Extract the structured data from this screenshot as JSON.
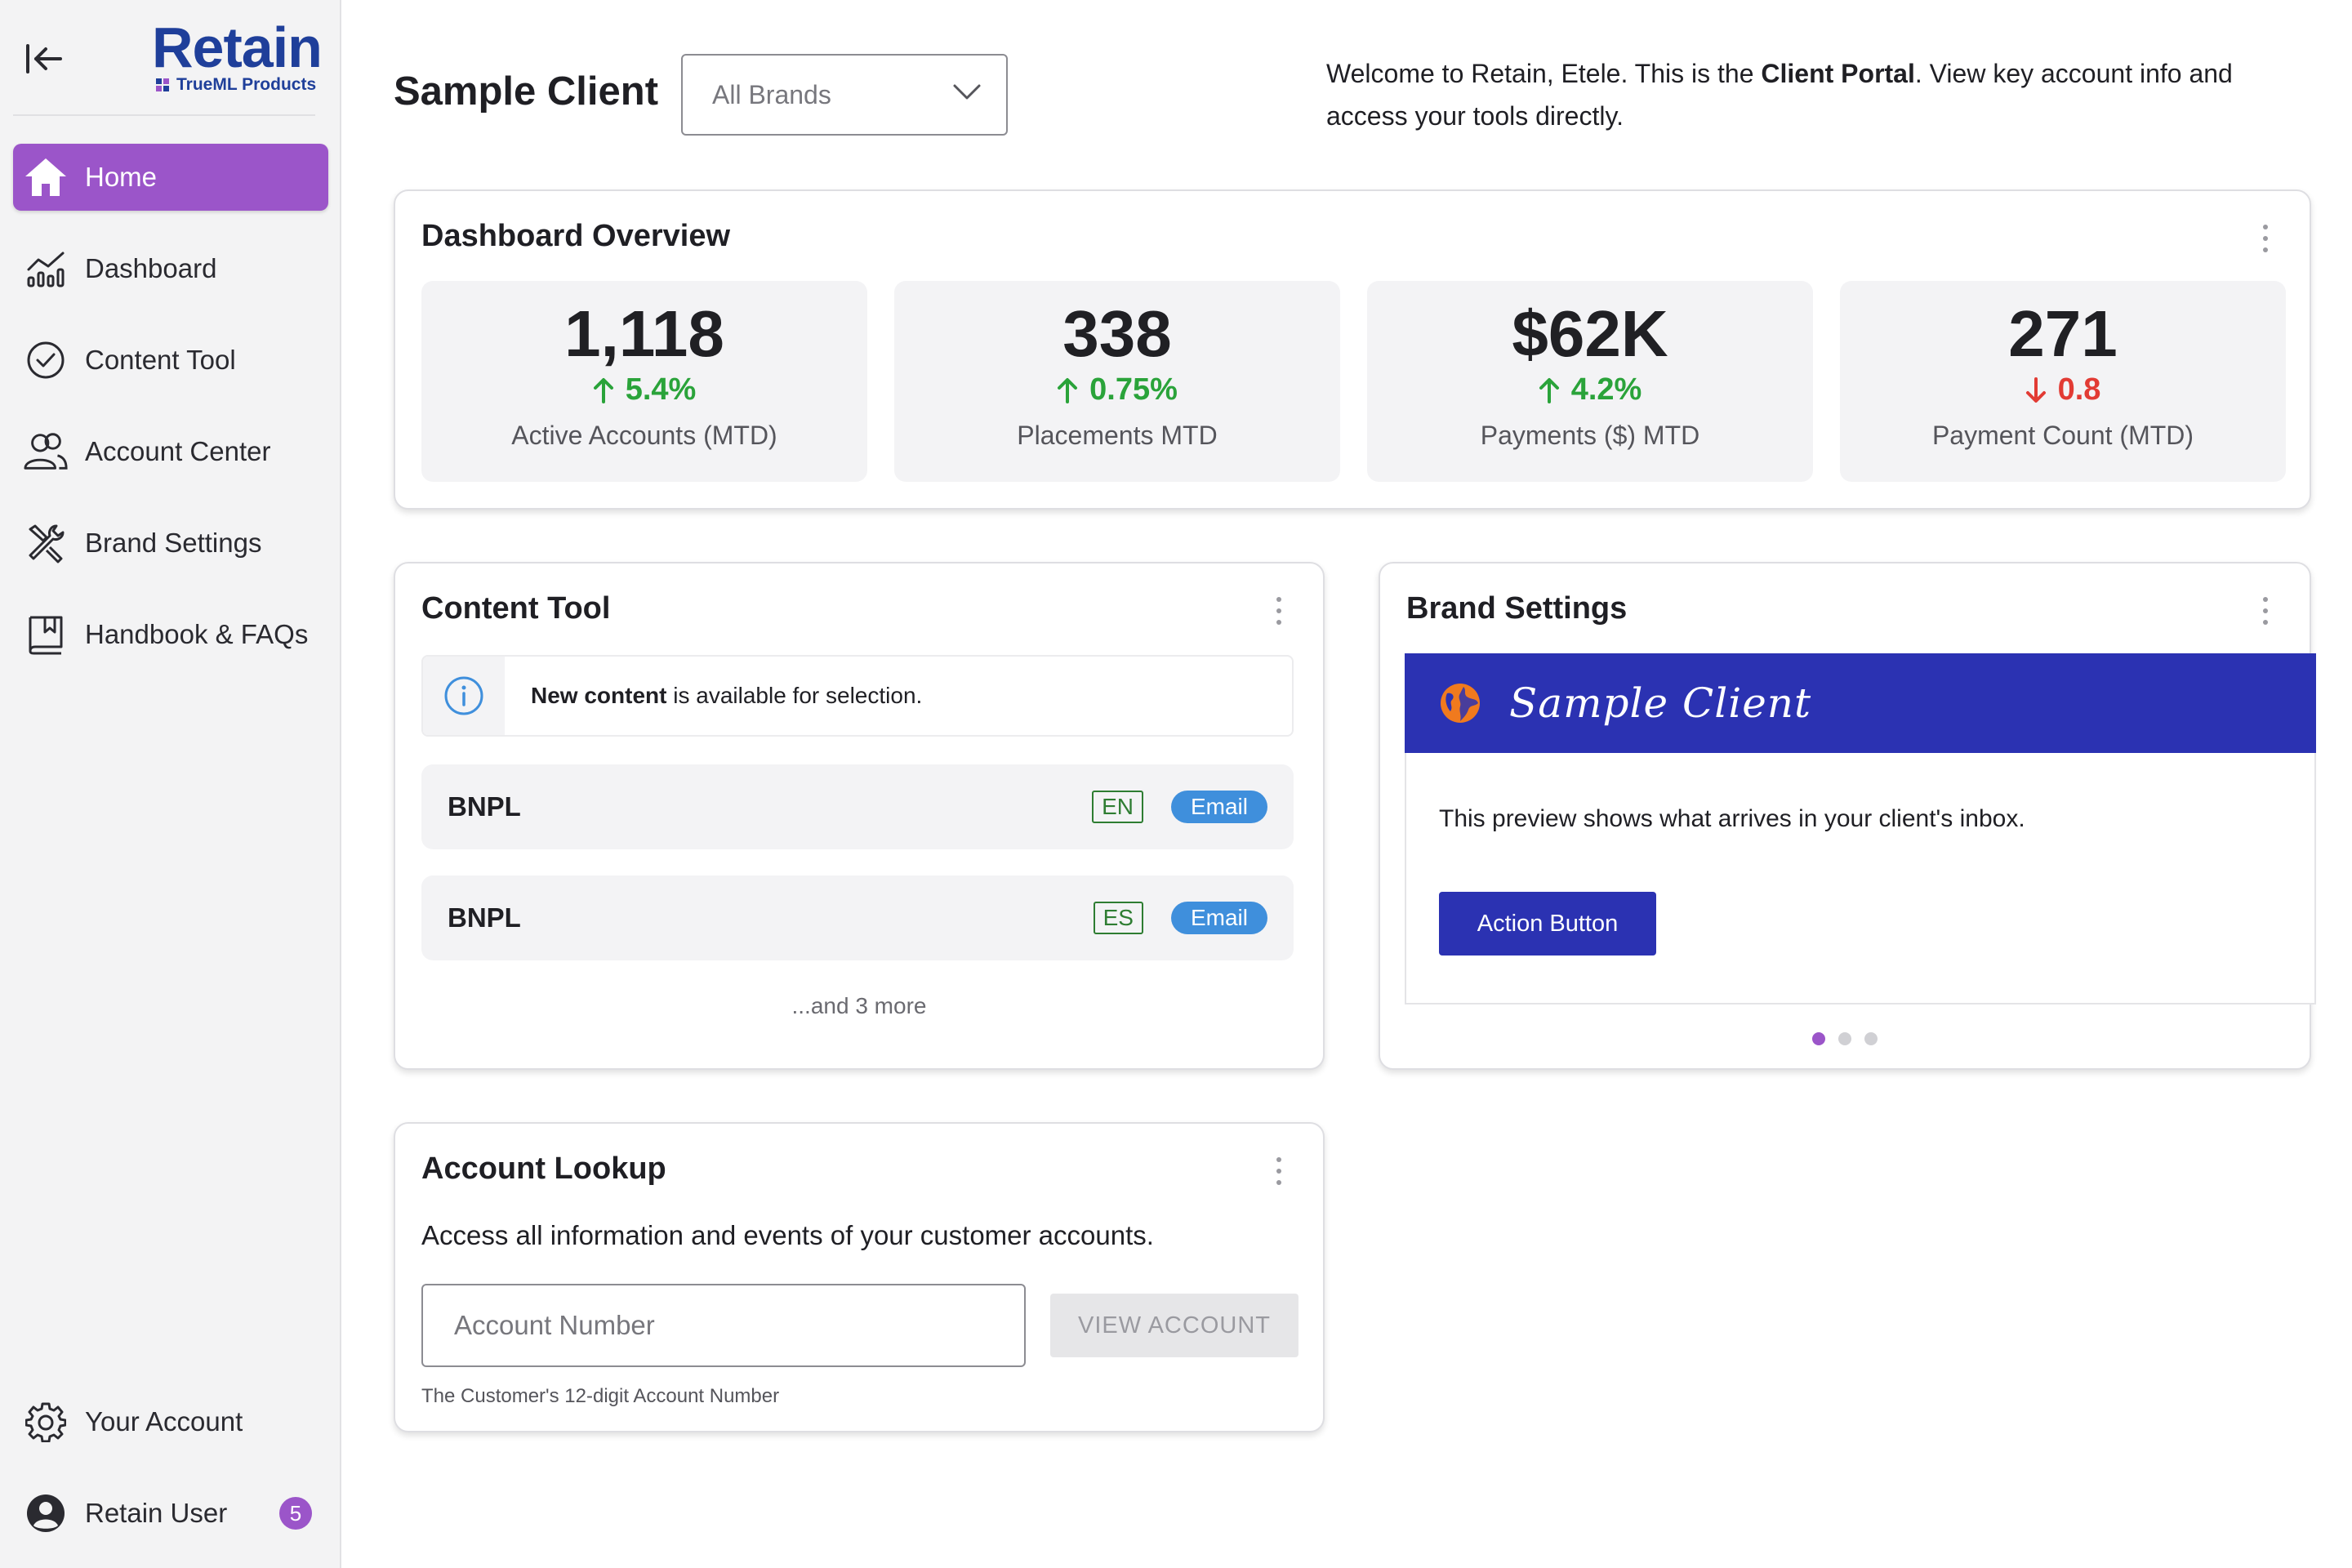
{
  "app": {
    "logo_title": "Retain",
    "logo_subtitle": "TrueML Products",
    "brand_color": "#1f3f9a",
    "accent_color": "#9b55c9"
  },
  "sidebar": {
    "items": [
      {
        "label": "Home",
        "icon": "home-icon",
        "active": true
      },
      {
        "label": "Dashboard",
        "icon": "chart-icon"
      },
      {
        "label": "Content Tool",
        "icon": "check-circle-icon"
      },
      {
        "label": "Account Center",
        "icon": "users-icon"
      },
      {
        "label": "Brand Settings",
        "icon": "tools-icon"
      },
      {
        "label": "Handbook & FAQs",
        "icon": "book-icon"
      }
    ],
    "bottom": [
      {
        "label": "Your Account",
        "icon": "gear-icon"
      },
      {
        "label": "Retain User",
        "icon": "user-avatar-icon",
        "badge": "5"
      }
    ]
  },
  "header": {
    "title": "Sample Client",
    "brand_select": "All Brands",
    "welcome_prefix": "Welcome to Retain, Etele. This is the ",
    "welcome_bold": "Client Portal",
    "welcome_suffix": ". View key account info and access your tools directly."
  },
  "overview": {
    "title": "Dashboard Overview",
    "stats": [
      {
        "value": "1,118",
        "delta": "5.4%",
        "direction": "up",
        "label": "Active Accounts (MTD)"
      },
      {
        "value": "338",
        "delta": "0.75%",
        "direction": "up",
        "label": "Placements MTD"
      },
      {
        "value": "$62K",
        "delta": "4.2%",
        "direction": "up",
        "label": "Payments ($) MTD"
      },
      {
        "value": "271",
        "delta": "0.8",
        "direction": "down",
        "label": "Payment Count (MTD)"
      }
    ],
    "up_color": "#2aa33a",
    "down_color": "#e23b34"
  },
  "content_tool": {
    "title": "Content Tool",
    "info_bold": "New content",
    "info_rest": " is available for selection.",
    "rows": [
      {
        "name": "BNPL",
        "lang": "EN",
        "type": "Email"
      },
      {
        "name": "BNPL",
        "lang": "ES",
        "type": "Email"
      }
    ],
    "more": "...and 3 more"
  },
  "brand_settings": {
    "title": "Brand Settings",
    "brand_name": "Sample Client",
    "banner_color": "#2b32b2",
    "preview_text": "This preview shows what arrives in your client's inbox.",
    "action_button": "Action Button",
    "carousel_total": 3,
    "carousel_active": 1
  },
  "account_lookup": {
    "title": "Account Lookup",
    "description": "Access all information and events of your customer accounts.",
    "input_placeholder": "Account Number",
    "button": "VIEW ACCOUNT",
    "helper": "The Customer's 12-digit Account Number"
  }
}
